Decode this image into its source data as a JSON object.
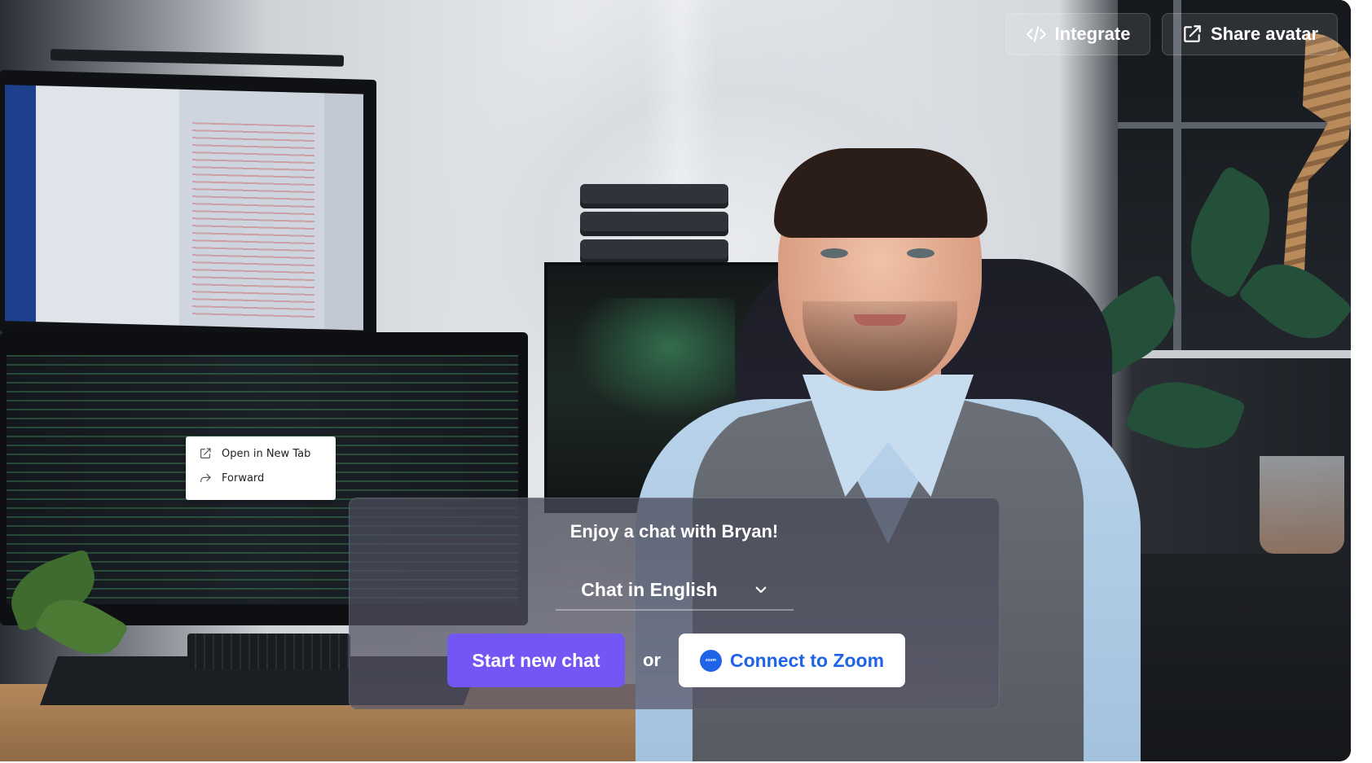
{
  "header": {
    "integrate_label": "Integrate",
    "share_label": "Share avatar"
  },
  "context_menu": {
    "items": [
      {
        "label": "Open in New Tab",
        "icon": "external-link-icon"
      },
      {
        "label": "Forward",
        "icon": "forward-arrow-icon"
      }
    ]
  },
  "chat_panel": {
    "title": "Enjoy a chat with Bryan!",
    "language_selected": "Chat in English",
    "start_label": "Start new chat",
    "or_label": "or",
    "zoom_label": "Connect to Zoom",
    "zoom_logo_text": "zoom"
  },
  "colors": {
    "primary_accent": "#7456f5",
    "zoom_blue": "#1f63e8",
    "text_on_dark": "#ffffff"
  }
}
